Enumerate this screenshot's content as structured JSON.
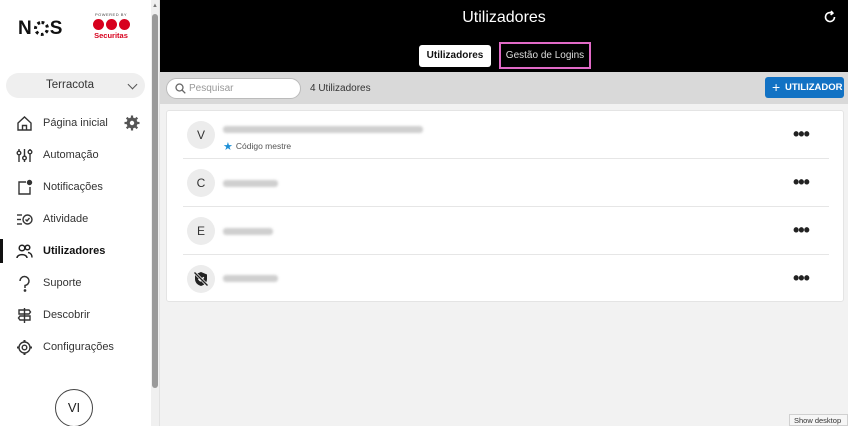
{
  "brand": {
    "nos": "NOS",
    "powered_by": "POWERED BY",
    "securitas": "Securitas"
  },
  "sidebar": {
    "location": "Terracota",
    "items": [
      {
        "label": "Página inicial",
        "icon": "home-icon"
      },
      {
        "label": "Automação",
        "icon": "sliders-icon"
      },
      {
        "label": "Notificações",
        "icon": "notification-icon"
      },
      {
        "label": "Atividade",
        "icon": "activity-icon"
      },
      {
        "label": "Utilizadores",
        "icon": "users-icon"
      },
      {
        "label": "Suporte",
        "icon": "support-icon"
      },
      {
        "label": "Descobrir",
        "icon": "signpost-icon"
      },
      {
        "label": "Configurações",
        "icon": "gear-icon"
      }
    ],
    "active_index": 4,
    "avatar": "VI"
  },
  "header": {
    "title": "Utilizadores",
    "tabs": [
      "Utilizadores",
      "Gestão de Logins"
    ]
  },
  "toolbar": {
    "search_placeholder": "Pesquisar",
    "count": "4 Utilizadores",
    "add_label": "UTILIZADOR"
  },
  "users": [
    {
      "avatar": "V",
      "subtitle": "Código mestre"
    },
    {
      "avatar": "C"
    },
    {
      "avatar": "E"
    },
    {
      "avatar": ""
    }
  ],
  "taskbar": {
    "show_desktop": "Show desktop"
  },
  "colors": {
    "accent": "#1272c4",
    "brand_red": "#d7001d",
    "highlight": "#e16ac7"
  }
}
